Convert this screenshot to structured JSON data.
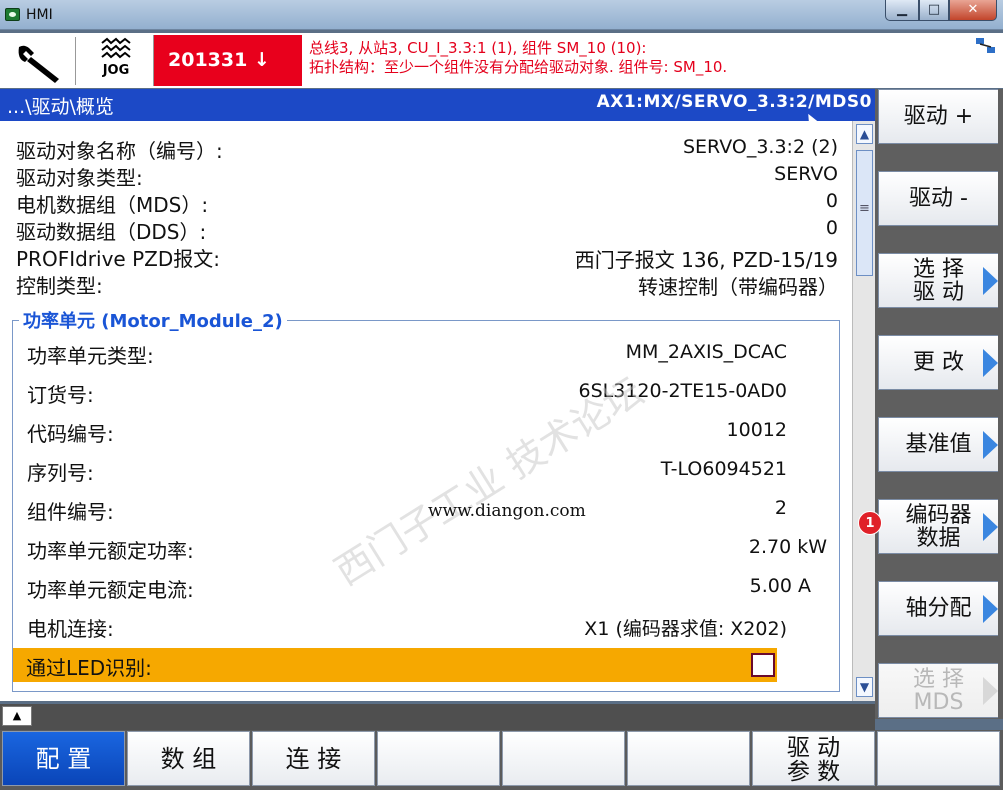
{
  "window": {
    "title": "HMI",
    "buttons": [
      "▁",
      "□",
      "✕"
    ]
  },
  "alarm": {
    "mode_label": "JOG",
    "code": "201331 ↓",
    "line1": "总线3, 从站3, CU_I_3.3:1 (1), 组件 SM_10 (10):",
    "line2": "拓扑结构：至少一个组件没有分配给驱动对象. 组件号: SM_10."
  },
  "header": {
    "path": "...\\驱动\\概览",
    "axis": "AX1:MX/SERVO_3.3:2/MDS0"
  },
  "info": [
    {
      "label": "驱动对象名称（编号）:",
      "value": "SERVO_3.3:2 (2)"
    },
    {
      "label": "驱动对象类型:",
      "value": "SERVO"
    },
    {
      "label": "电机数据组（MDS）:",
      "value": "0"
    },
    {
      "label": "驱动数据组（DDS）:",
      "value": "0"
    },
    {
      "label": "PROFIdrive PZD报文:",
      "value": "西门子报文 136, PZD-15/19"
    },
    {
      "label": "控制类型:",
      "value": "转速控制（带编码器）"
    }
  ],
  "group": {
    "title": "功率单元 (Motor_Module_2)",
    "rows": [
      {
        "label": "功率单元类型:",
        "value": "MM_2AXIS_DCAC"
      },
      {
        "label": "订货号:",
        "value": "6SL3120-2TE15-0AD0"
      },
      {
        "label": "代码编号:",
        "value": "10012"
      },
      {
        "label": "序列号:",
        "value": "T-LO6094521"
      },
      {
        "label": "组件编号:",
        "value": "2"
      },
      {
        "label": "功率单元额定功率:",
        "value": "2.70 kW"
      },
      {
        "label": "功率单元额定电流:",
        "value": "5.00 A"
      },
      {
        "label": "电机连接:",
        "value": "X1 (编码器求值: X202)"
      }
    ],
    "led_label": "通过LED识别:",
    "led_checked": false
  },
  "watermark": {
    "text": "www.diangon.com",
    "overlay": "西门子工业 技术论坛"
  },
  "vertical_softkeys": [
    {
      "label": "驱动 +"
    },
    {
      "label": "驱动 -"
    },
    {
      "label1": "选 择",
      "label2": "驱 动"
    },
    {
      "label": "更 改"
    },
    {
      "label": "基准值"
    },
    {
      "label1": "编码器",
      "label2": "数据"
    },
    {
      "label": "轴分配"
    },
    {
      "label1": "选 择",
      "label2": "MDS"
    }
  ],
  "badge": "1",
  "horizontal_softkeys": [
    {
      "label": "配 置"
    },
    {
      "label": "数 组"
    },
    {
      "label": "连 接"
    },
    {
      "label": ""
    },
    {
      "label": ""
    },
    {
      "label": ""
    },
    {
      "label1": "驱 动",
      "label2": "参 数"
    },
    {
      "label": ""
    }
  ],
  "colors": {
    "header": "#1c49c6",
    "alarm_code_bg": "#e8001c",
    "led_row": "#f6a800",
    "active_softkey": "#1a66e0"
  }
}
